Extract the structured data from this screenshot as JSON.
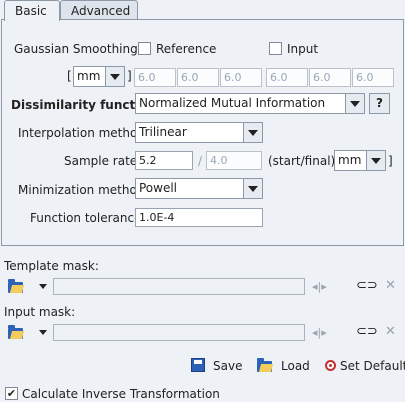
{
  "tabs": [
    {
      "label": "Basic"
    },
    {
      "label": "Advanced"
    }
  ],
  "basic": {
    "gaussian": {
      "label": "Gaussian Smoothing",
      "reference_label": "Reference",
      "input_label": "Input",
      "bracket_open": "[",
      "bracket_close": "]",
      "unit": "mm",
      "reference_values": [
        "6.0",
        "6.0",
        "6.0"
      ],
      "input_values": [
        "6.0",
        "6.0",
        "6.0"
      ]
    },
    "dissimilarity": {
      "label": "Dissimilarity function",
      "value": "Normalized Mutual Information",
      "help_label": "?"
    },
    "interpolation": {
      "label": "Interpolation method",
      "value": "Trilinear"
    },
    "sample_rate": {
      "label": "Sample rate",
      "start": "5.2",
      "slash": "/",
      "final": "4.0",
      "note": "(start/final)",
      "bracket_open": "[",
      "bracket_close": "]",
      "unit": "mm"
    },
    "minimization": {
      "label": "Minimization method",
      "value": "Powell"
    },
    "tolerance": {
      "label": "Function tolerance",
      "value": "1.0E-4"
    }
  },
  "template_mask": {
    "label": "Template mask:",
    "value": ""
  },
  "input_mask": {
    "label": "Input mask:",
    "value": ""
  },
  "actions": {
    "save": "Save",
    "load": "Load",
    "set_default": "Set Default"
  },
  "inverse": {
    "label": "Calculate Inverse Transformation",
    "checked": true
  },
  "colors": {
    "accent": "#2e62b8",
    "background": "#eef1f5",
    "border": "#8e99a8"
  }
}
